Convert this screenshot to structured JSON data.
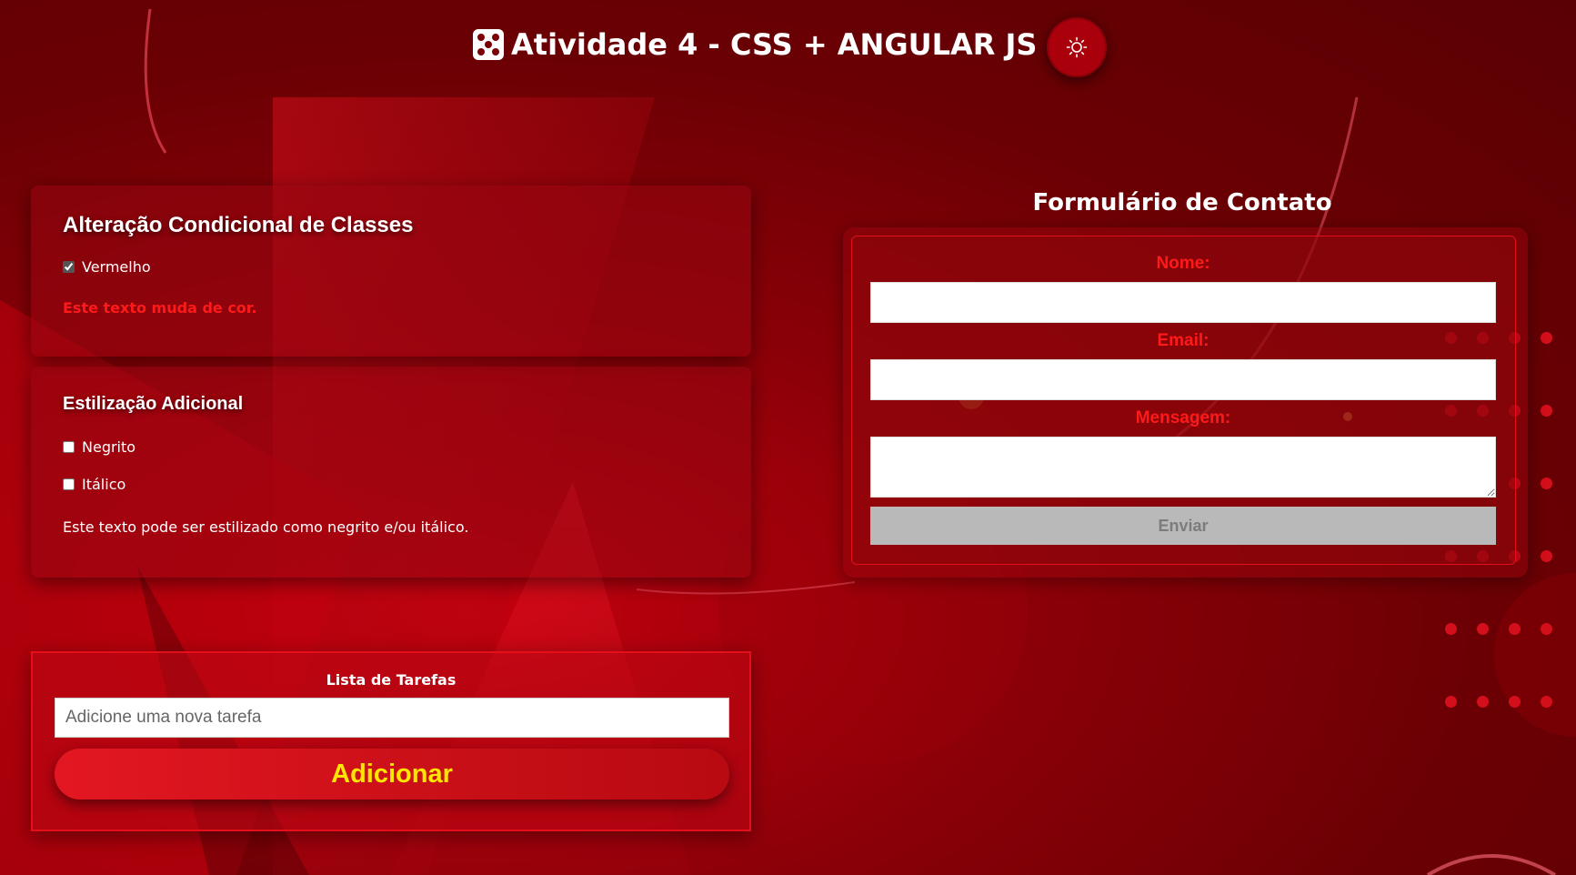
{
  "header": {
    "title": "Atividade 4 - CSS + ANGULAR JS",
    "dice_icon": "dice-five-icon",
    "theme_toggle_icon": "sun-icon"
  },
  "conditional_classes": {
    "title": "Alteração Condicional de Classes",
    "checkbox_label": "Vermelho",
    "checkbox_checked": true,
    "sample_text": "Este texto muda de cor."
  },
  "additional_styling": {
    "title": "Estilização Adicional",
    "bold_label": "Negrito",
    "bold_checked": false,
    "italic_label": "Itálico",
    "italic_checked": false,
    "sample_text": "Este texto pode ser estilizado como negrito e/ou itálico."
  },
  "tasks": {
    "title": "Lista de Tarefas",
    "input_placeholder": "Adicione uma nova tarefa",
    "input_value": "",
    "add_label": "Adicionar"
  },
  "contact_form": {
    "title": "Formulário de Contato",
    "name_label": "Nome:",
    "name_value": "",
    "email_label": "Email:",
    "email_value": "",
    "message_label": "Mensagem:",
    "message_value": "",
    "submit_label": "Enviar"
  },
  "colors": {
    "background": "#7a0005",
    "accent_red": "#ff1a1a",
    "button_text_yellow": "#ffe600",
    "disabled_button": "#b9b9b9"
  }
}
